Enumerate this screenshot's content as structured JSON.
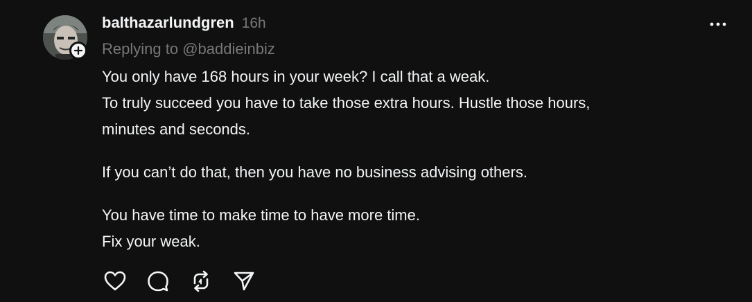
{
  "post": {
    "username": "balthazarlundgren",
    "timestamp": "16h",
    "replying_prefix": "Replying to ",
    "replying_to": "@baddieinbiz",
    "paragraphs": [
      {
        "lines": [
          "You only have 168 hours in your week? I call that a weak.",
          "To truly succeed you have to take those extra hours. Hustle those hours,",
          "minutes and seconds."
        ]
      },
      {
        "lines": [
          "If you can’t do that, then you have no business advising others."
        ]
      },
      {
        "lines": [
          "You have time to make time to have more time.",
          "Fix your weak."
        ]
      }
    ]
  },
  "icons": {
    "more": "more-horizontal-icon",
    "follow": "plus-icon",
    "like": "heart-icon",
    "comment": "comment-icon",
    "repost": "repost-icon",
    "share": "send-icon"
  },
  "colors": {
    "background": "#101010",
    "text_primary": "#f3f5f7",
    "text_secondary": "#777777"
  }
}
